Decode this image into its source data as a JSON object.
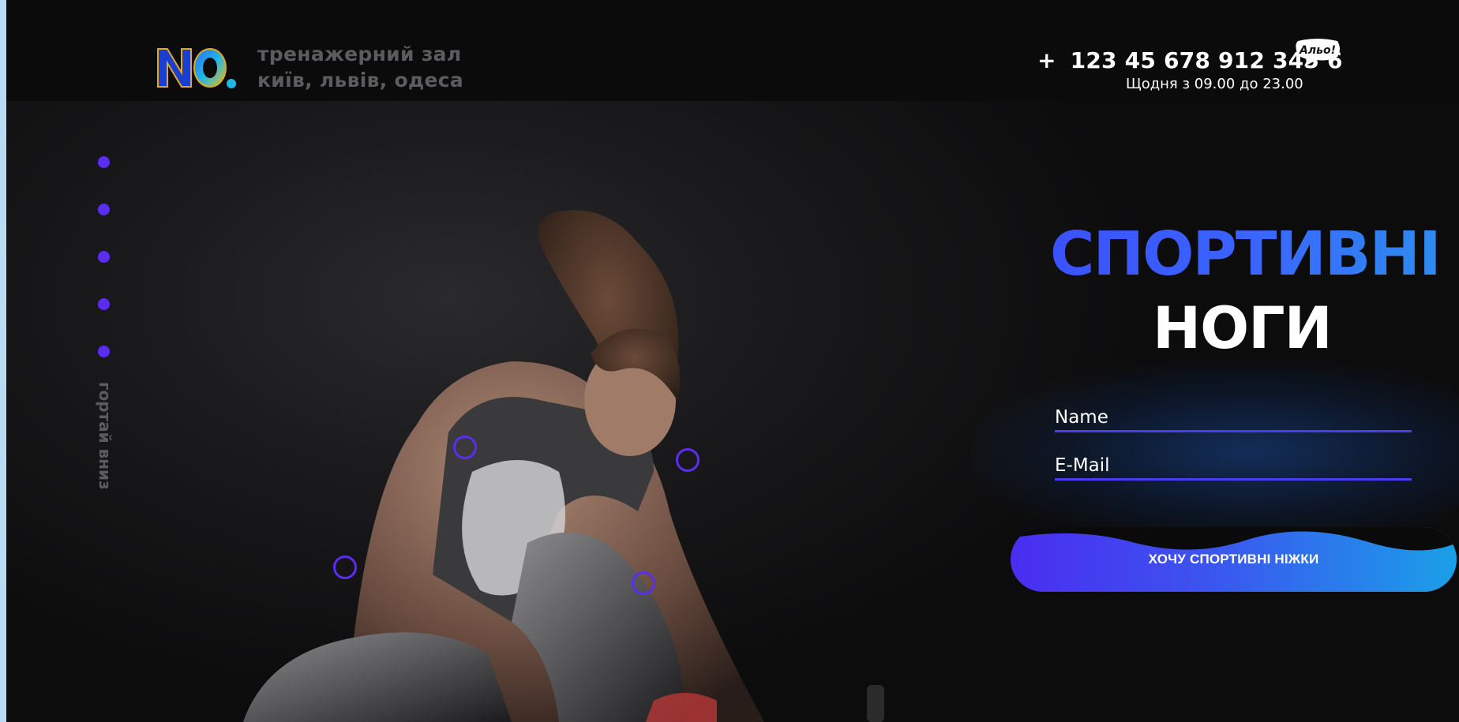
{
  "brand": {
    "logo_text": "NO.",
    "tagline_line1": "тренажерний зал",
    "tagline_line2": "київ, львів, одеса"
  },
  "contact": {
    "phone_prefix": "+",
    "phone": "123 45 678 912 345 6",
    "bubble": "Альо!",
    "hours": "Щодня з 09.00 до 23.00"
  },
  "nav": {
    "dot_count": 5,
    "scroll_hint": "гортай вниз"
  },
  "hero": {
    "title_line1": "СПОРТИВНІ",
    "title_line2": "НОГИ"
  },
  "form": {
    "name_placeholder": "Name",
    "email_placeholder": "E-Mail",
    "submit_label": "ХОЧУ СПОРТИВНІ НІЖКИ"
  },
  "colors": {
    "accent": "#5a2df0",
    "title_gradient_start": "#3b52ff",
    "title_gradient_end": "#2d8cf0",
    "button_gradient_start": "#4a2df0",
    "button_gradient_end": "#1aa0e8",
    "muted_text": "#5c5c60"
  }
}
